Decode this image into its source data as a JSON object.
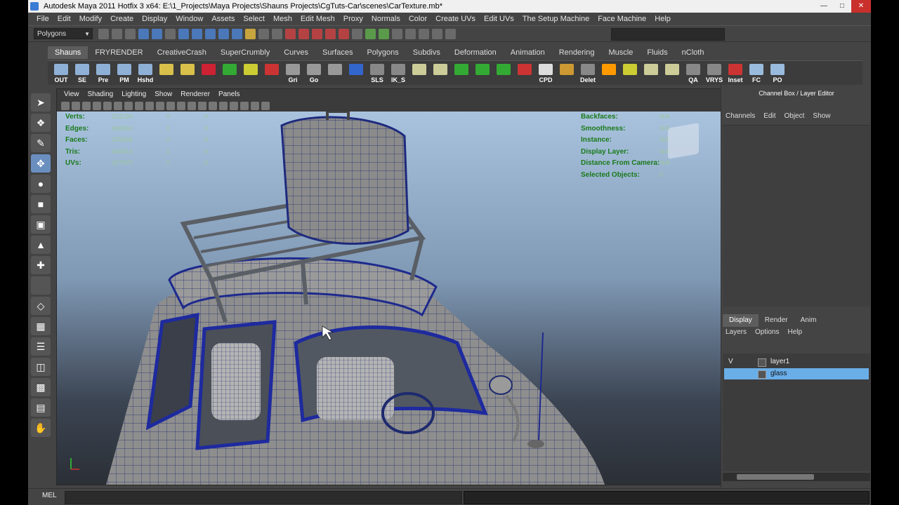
{
  "window": {
    "title": "Autodesk Maya 2011 Hotfix 3 x64: E:\\1_Projects\\Maya Projects\\Shauns Projects\\CgTuts-Car\\scenes\\CarTexture.mb*"
  },
  "menubar": [
    "File",
    "Edit",
    "Modify",
    "Create",
    "Display",
    "Window",
    "Assets",
    "Select",
    "Mesh",
    "Edit Mesh",
    "Proxy",
    "Normals",
    "Color",
    "Create UVs",
    "Edit UVs",
    "The Setup Machine",
    "Face Machine",
    "Help"
  ],
  "status_line": {
    "mode": "Polygons"
  },
  "shelf_tabs": [
    "Shauns",
    "FRYRENDER",
    "CreativeCrash",
    "SuperCrumbly",
    "Curves",
    "Surfaces",
    "Polygons",
    "Subdivs",
    "Deformation",
    "Animation",
    "Rendering",
    "Muscle",
    "Fluids",
    "nCloth"
  ],
  "shelf_buttons": [
    "OUT",
    "SE",
    "Pre",
    "PM",
    "Hshd",
    "",
    "",
    "",
    "",
    "",
    "",
    "Gri",
    "Go",
    "",
    "",
    "SLS",
    "IK_S",
    "",
    "",
    "",
    "",
    "",
    "",
    "CPD",
    "",
    "Delet",
    "",
    "",
    "",
    "",
    "QA",
    "VRYS",
    "Inset",
    "FC",
    "PO"
  ],
  "viewport": {
    "menu": [
      "View",
      "Shading",
      "Lighting",
      "Show",
      "Renderer",
      "Panels"
    ],
    "hud_left": [
      {
        "label": "Verts:",
        "v1": "223194",
        "v2": "0",
        "v3": "0"
      },
      {
        "label": "Edges:",
        "v1": "468360",
        "v2": "0",
        "v3": "0"
      },
      {
        "label": "Faces:",
        "v1": "225666",
        "v2": "0",
        "v3": "0"
      },
      {
        "label": "Tris:",
        "v1": "440916",
        "v2": "0",
        "v3": "0"
      },
      {
        "label": "UVs:",
        "v1": "327970",
        "v2": "0",
        "v3": "0"
      }
    ],
    "hud_right": [
      {
        "label": "Backfaces:",
        "value": "N/A"
      },
      {
        "label": "Smoothness:",
        "value": "N/A"
      },
      {
        "label": "Instance:",
        "value": "N/A"
      },
      {
        "label": "Display Layer:",
        "value": "N/A"
      },
      {
        "label": "Distance From Camera:",
        "value": "N/A"
      },
      {
        "label": "Selected Objects:",
        "value": "0"
      }
    ],
    "viewcube": {
      "left": "LEFT",
      "front": "FRONT"
    }
  },
  "channel_box": {
    "title": "Channel Box / Layer Editor",
    "menu": [
      "Channels",
      "Edit",
      "Object",
      "Show"
    ]
  },
  "layer_editor": {
    "tabs": [
      "Display",
      "Render",
      "Anim"
    ],
    "menu": [
      "Layers",
      "Options",
      "Help"
    ],
    "layers": [
      {
        "vis": "V",
        "name": "layer1",
        "selected": false
      },
      {
        "vis": "",
        "name": "glass",
        "selected": true
      }
    ]
  },
  "command_line": {
    "label": "MEL"
  },
  "colors": {
    "accent": "#6aaee8",
    "hud_green": "#1a7a1a",
    "background": "#444444"
  }
}
